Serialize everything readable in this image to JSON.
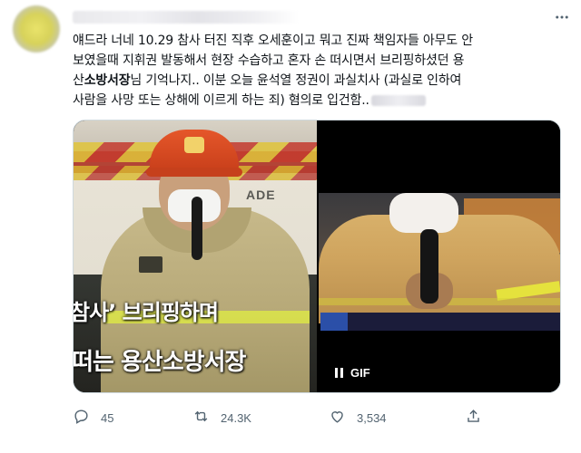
{
  "tweet": {
    "text_line1": "얘드라 너네 10.29 참사 터진 직후 오세훈이고 뭐고 진짜 책임자들 아무도 안",
    "text_line2": "보였을때 지휘권 발동해서 현장 수습하고 혼자 손 떠시면서 브리핑하셨던 용",
    "text_line3a": "산",
    "text_line3b_bold": "소방서장",
    "text_line3c": "님 기억나지.. 이분 오늘 윤석열 정권이 과실치사 (과실로 인하여",
    "text_line4": "사람을 사망 또는 상해에 이르게 하는 죄) 혐의로 입건함.."
  },
  "media": {
    "left_caption_line1": "참사’ 브리핑하며",
    "left_caption_line2": "떠는 용산소방서장",
    "truck_text": "ADE",
    "gif_label": "GIF"
  },
  "actions": {
    "reply_count": "45",
    "retweet_count": "24.3K",
    "like_count": "3,534"
  },
  "icons": {
    "more": "more-icon",
    "reply": "reply-icon",
    "retweet": "retweet-icon",
    "like": "like-icon",
    "share": "share-icon",
    "pause": "pause-icon"
  },
  "colors": {
    "text": "#0f1419",
    "secondary": "#536471",
    "border": "#cfd9de"
  }
}
